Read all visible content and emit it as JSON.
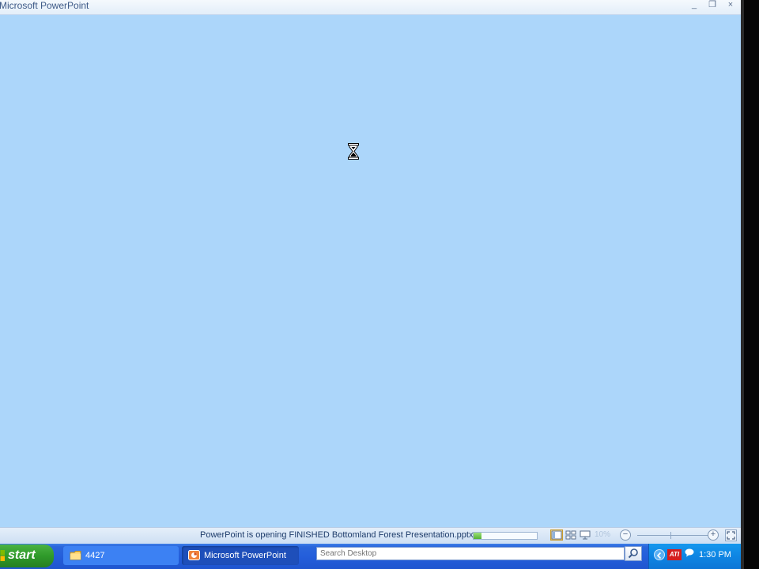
{
  "window": {
    "title": "Microsoft PowerPoint",
    "controls": {
      "minimize": "_",
      "restore": "❐",
      "close": "×"
    }
  },
  "statusbar": {
    "message": "PowerPoint is opening FINISHED Bottomland Forest Presentation.pptx.",
    "progress_fraction": 0.12,
    "zoom_label": "10%",
    "zoom_minus": "−",
    "zoom_plus": "+"
  },
  "cursor": {
    "icon": "hourglass-icon"
  },
  "taskbar": {
    "start_label": "start",
    "tasks": [
      {
        "label": "4427",
        "icon": "folder-icon"
      },
      {
        "label": "Microsoft PowerPoint",
        "icon": "powerpoint-icon"
      }
    ],
    "search_placeholder": "Search Desktop",
    "clock": "1:30 PM",
    "tray_ati_label": "ATI"
  },
  "colors": {
    "document_background": "#acd6fa",
    "taskbar": "#245edb",
    "start_button": "#2f9a2a",
    "tray": "#0e85e3"
  }
}
